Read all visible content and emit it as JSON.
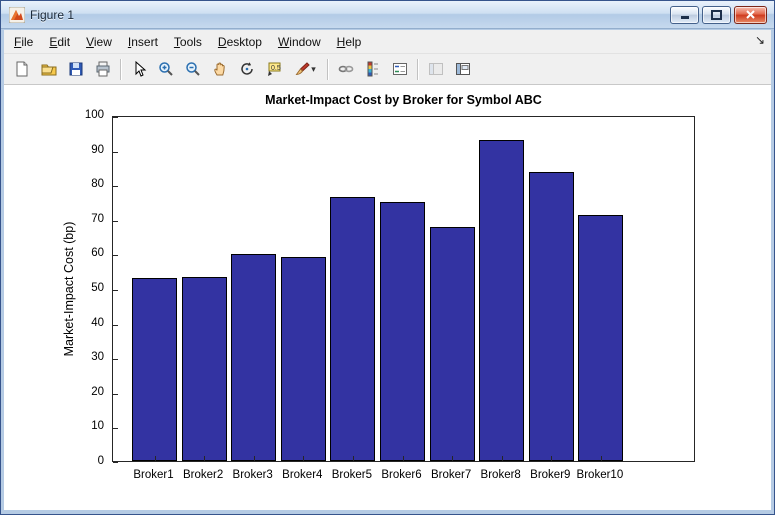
{
  "window": {
    "title": "Figure 1",
    "controls": {
      "minimize": "minimize",
      "maximize": "maximize",
      "close": "close"
    }
  },
  "menubar": {
    "items": [
      "File",
      "Edit",
      "View",
      "Insert",
      "Tools",
      "Desktop",
      "Window",
      "Help"
    ],
    "dock_glyph": "↘"
  },
  "toolbar": {
    "icons": [
      "new-figure-icon",
      "open-file-icon",
      "save-figure-icon",
      "print-figure-icon",
      "edit-plot-arrow-icon",
      "zoom-in-icon",
      "zoom-out-icon",
      "pan-hand-icon",
      "rotate-3d-icon",
      "data-cursor-icon",
      "brush-data-icon",
      "brush-dropdown-caret",
      "link-plot-icon",
      "insert-colorbar-icon",
      "insert-legend-icon",
      "hide-plot-tools-icon",
      "show-plot-tools-icon"
    ],
    "brush_caret": "▾"
  },
  "chart_data": {
    "type": "bar",
    "title": "Market-Impact Cost by Broker for Symbol ABC",
    "ylabel": "Market-Impact Cost (bp)",
    "xlabel": "",
    "categories": [
      "Broker1",
      "Broker2",
      "Broker3",
      "Broker4",
      "Broker5",
      "Broker6",
      "Broker7",
      "Broker8",
      "Broker9",
      "Broker10"
    ],
    "values": [
      52.9,
      53.2,
      59.8,
      59.1,
      76.2,
      74.9,
      67.6,
      92.9,
      83.6,
      71.0
    ],
    "ylim": [
      0,
      100
    ],
    "ytick_step": 10,
    "grid": false,
    "legend": null,
    "bar_color": "#3333a2",
    "bar_edge_color": "#000000"
  },
  "colors": {
    "close_button": "#ce3a1e",
    "titlebar_blue": "#b2cbe6",
    "ui_gray": "#f0f0f0"
  }
}
